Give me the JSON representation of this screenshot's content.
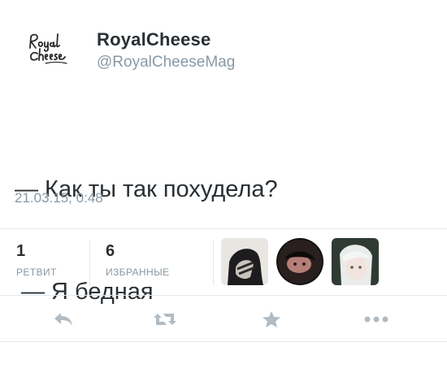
{
  "user": {
    "name": "RoyalCheese",
    "handle": "@RoyalCheeseMag",
    "avatar_icon": "royal-cheese-logo"
  },
  "tweet": {
    "line1": "— Как ты так похудела?",
    "line2": "— Я бедная",
    "timestamp": "21.03.15, 0:48"
  },
  "stats": {
    "retweets": {
      "count": "1",
      "label": "РЕТВИТ"
    },
    "favorites": {
      "count": "6",
      "label": "ИЗБРАННЫЕ"
    }
  },
  "favoriters": [
    "avatar-1",
    "avatar-2",
    "avatar-3"
  ],
  "actions": [
    {
      "name": "reply",
      "icon": "reply-icon"
    },
    {
      "name": "retweet",
      "icon": "retweet-icon"
    },
    {
      "name": "favorite",
      "icon": "star-icon"
    },
    {
      "name": "more",
      "icon": "more-icon"
    }
  ],
  "colors": {
    "text": "#292f33",
    "muted": "#8899a6",
    "border": "#e1e8ed",
    "icon": "#b1bbc3"
  }
}
